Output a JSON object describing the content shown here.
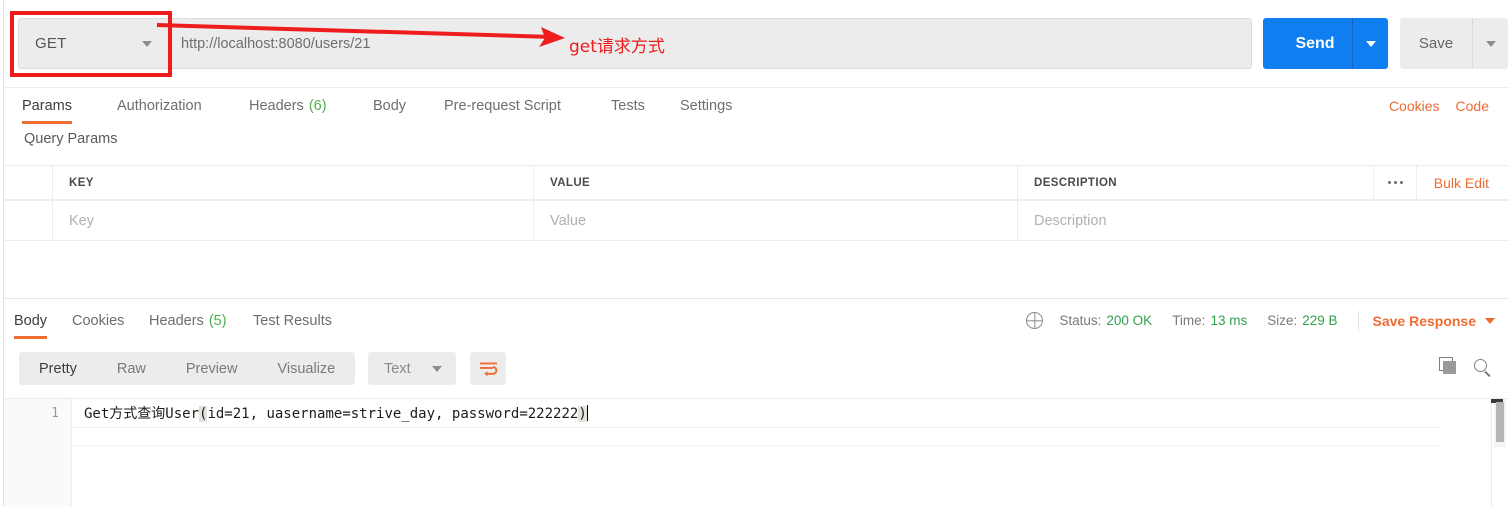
{
  "request": {
    "method": "GET",
    "url": "http://localhost:8080/users/21",
    "send_label": "Send",
    "save_label": "Save",
    "tabs": [
      {
        "label": "Params",
        "badge": "",
        "active": true
      },
      {
        "label": "Authorization",
        "badge": "",
        "active": false
      },
      {
        "label": "Headers",
        "badge": "(6)",
        "active": false
      },
      {
        "label": "Body",
        "badge": "",
        "active": false
      },
      {
        "label": "Pre-request Script",
        "badge": "",
        "active": false
      },
      {
        "label": "Tests",
        "badge": "",
        "active": false
      },
      {
        "label": "Settings",
        "badge": "",
        "active": false
      }
    ],
    "cookies_link": "Cookies",
    "code_link": "Code"
  },
  "query_params": {
    "title": "Query Params",
    "headers": {
      "key": "KEY",
      "value": "VALUE",
      "description": "DESCRIPTION"
    },
    "placeholders": {
      "key": "Key",
      "value": "Value",
      "description": "Description"
    },
    "bulk_edit_label": "Bulk Edit"
  },
  "response": {
    "tabs": [
      {
        "label": "Body",
        "badge": "",
        "active": true
      },
      {
        "label": "Cookies",
        "badge": "",
        "active": false
      },
      {
        "label": "Headers",
        "badge": "(5)",
        "active": false
      },
      {
        "label": "Test Results",
        "badge": "",
        "active": false
      }
    ],
    "status_label": "Status:",
    "status_value": "200 OK",
    "time_label": "Time:",
    "time_value": "13 ms",
    "size_label": "Size:",
    "size_value": "229 B",
    "save_response_label": "Save Response",
    "view_modes": [
      {
        "label": "Pretty",
        "active": true
      },
      {
        "label": "Raw",
        "active": false
      },
      {
        "label": "Preview",
        "active": false
      },
      {
        "label": "Visualize",
        "active": false
      }
    ],
    "format_selected": "Text",
    "line_number": "1",
    "body_prefix": "Get方式查询User",
    "body_open_paren": "(",
    "body_inner": "id=21, uasername=strive_day, password=222222",
    "body_close_paren": ")"
  },
  "annotation": {
    "text": "get请求方式",
    "color": "#ee1c1c"
  },
  "colors": {
    "accent_orange": "#ef6c33",
    "send_blue": "#0f7ef0",
    "status_green": "#30a14e",
    "annotation_red": "#ee1c1c"
  }
}
